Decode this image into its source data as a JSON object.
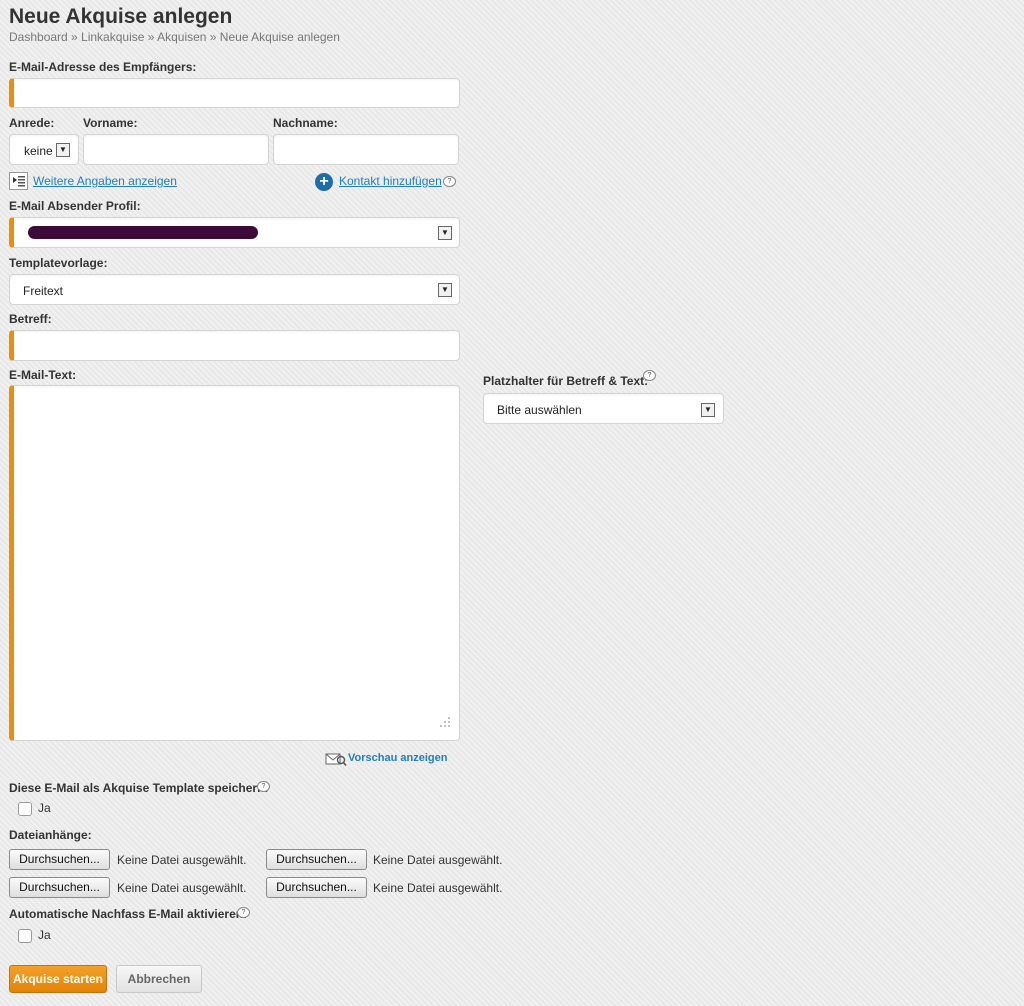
{
  "page": {
    "title": "Neue Akquise anlegen",
    "breadcrumb": "Dashboard » Linkakquise » Akquisen » Neue Akquise anlegen"
  },
  "form": {
    "email_label": "E-Mail-Adresse des Empfängers:",
    "email_value": "",
    "anrede_label": "Anrede:",
    "anrede_value": "keine",
    "vorname_label": "Vorname:",
    "vorname_value": "",
    "nachname_label": "Nachname:",
    "nachname_value": "",
    "more_details_link": "Weitere Angaben anzeigen",
    "add_contact_link": "Kontakt hinzufügen",
    "sender_label": "E-Mail Absender Profil:",
    "template_label": "Templatevorlage:",
    "template_value": "Freitext",
    "subject_label": "Betreff:",
    "subject_value": "",
    "body_label": "E-Mail-Text:",
    "body_value": "",
    "placeholder_label": "Platzhalter für Betreff & Text:",
    "placeholder_value": "Bitte auswählen",
    "preview_link": "Vorschau anzeigen",
    "save_template_label": "Diese E-Mail als Akquise Template speichern:",
    "save_template_option": "Ja",
    "attachments_label": "Dateianhänge:",
    "attachments": [
      {
        "button": "Durchsuchen...",
        "status": "Keine Datei ausgewählt."
      },
      {
        "button": "Durchsuchen...",
        "status": "Keine Datei ausgewählt."
      },
      {
        "button": "Durchsuchen...",
        "status": "Keine Datei ausgewählt."
      },
      {
        "button": "Durchsuchen...",
        "status": "Keine Datei ausgewählt."
      }
    ],
    "followup_label": "Automatische Nachfass E-Mail aktivieren:",
    "followup_option": "Ja",
    "submit_label": "Akquise starten",
    "cancel_label": "Abbrechen"
  },
  "colors": {
    "accent": "#e8900e",
    "link": "#1f7fbf",
    "redaction": "#3d0a3a"
  },
  "icons": {
    "more_details": "list-icon",
    "add_contact": "plus-circle-icon",
    "help": "help-bubble-icon",
    "preview": "envelope-magnifier-icon"
  }
}
